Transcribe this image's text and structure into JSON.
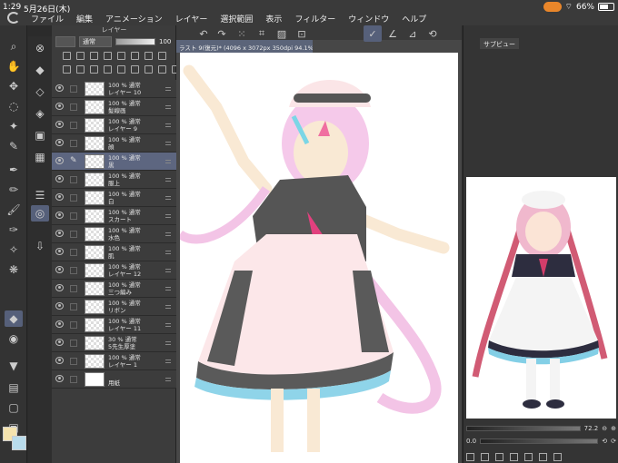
{
  "status": {
    "time": "1:29",
    "date": "5月26日(木)",
    "battery": "66%",
    "battery_fraction": 0.66
  },
  "menu": [
    "ファイル",
    "編集",
    "アニメーション",
    "レイヤー",
    "選択範囲",
    "表示",
    "フィルター",
    "ウィンドウ",
    "ヘルプ"
  ],
  "layer_panel": {
    "title": "レイヤー",
    "blend_mode": "通常",
    "opacity": "100",
    "layers": [
      {
        "opacity_mode": "100 % 通常",
        "name": "レイヤー 10"
      },
      {
        "opacity_mode": "100 % 通常",
        "name": "髪線画"
      },
      {
        "opacity_mode": "100 % 通常",
        "name": "レイヤー 9"
      },
      {
        "opacity_mode": "100 % 通常",
        "name": "顔"
      },
      {
        "opacity_mode": "100 % 通常",
        "name": "黒"
      },
      {
        "opacity_mode": "100 % 通常",
        "name": "服上"
      },
      {
        "opacity_mode": "100 % 通常",
        "name": "白"
      },
      {
        "opacity_mode": "100 % 通常",
        "name": "スカート"
      },
      {
        "opacity_mode": "100 % 通常",
        "name": "水色"
      },
      {
        "opacity_mode": "100 % 通常",
        "name": "肌"
      },
      {
        "opacity_mode": "100 % 通常",
        "name": "レイヤー 12"
      },
      {
        "opacity_mode": "100 % 通常",
        "name": "三つ編み"
      },
      {
        "opacity_mode": "100 % 通常",
        "name": "リボン"
      },
      {
        "opacity_mode": "100 % 通常",
        "name": "レイヤー 11"
      },
      {
        "opacity_mode": "30 % 通常",
        "name": "5先生厚塗"
      },
      {
        "opacity_mode": "100 % 通常",
        "name": "レイヤー 1"
      },
      {
        "opacity_mode": "",
        "name": "用紙"
      }
    ]
  },
  "document": {
    "tab_title": "ラスト 9(復元)* (4096 x 3072px 350dpi 94.1%)"
  },
  "subview": {
    "title": "サブビュー",
    "zoom": "72.2",
    "rotation": "0.0"
  },
  "colors": {
    "main": "#f5e3ae",
    "sub": "#b9dcec",
    "selected_layer": "#5d6680"
  }
}
